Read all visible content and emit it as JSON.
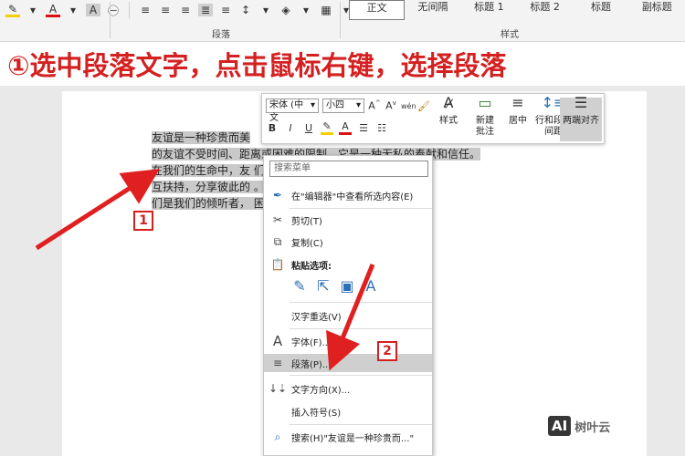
{
  "ribbon": {
    "paragraph_group": "段落",
    "styles_group": "样式",
    "styles": [
      "正文",
      "无间隔",
      "标题 1",
      "标题 2",
      "标题",
      "副标题"
    ]
  },
  "banner": {
    "text": "①选中段落文字，点击鼠标右键，选择段落"
  },
  "document": {
    "lines": [
      "友谊是一种珍贵而美",
      "的友谊不受时间、距离或困难的限制。它是一种无私的奉献和信任。",
      "在我们的生命中，友                         们与他人的心灵。朋友们相",
      "互扶持，分享彼此的                          。他们总是在我们身边。他",
      "们是我们的倾听者，                           困难时刻感到坚强和勇敢。"
    ]
  },
  "mini_toolbar": {
    "font": "宋体 (中文",
    "size": "小四",
    "buttons": [
      {
        "label": "样式",
        "icon": "styles-icon"
      },
      {
        "label": "新建\n批注",
        "icon": "new-comment-icon"
      },
      {
        "label": "居中",
        "icon": "center-icon"
      },
      {
        "label": "行和段落\n间距",
        "icon": "line-spacing-icon"
      },
      {
        "label": "两端对齐",
        "icon": "justify-icon"
      }
    ]
  },
  "context_menu": {
    "search_placeholder": "搜索菜单",
    "items": {
      "view_in_editor": "在\"编辑器\"中查看所选内容(E)",
      "cut": "剪切(T)",
      "copy": "复制(C)",
      "paste_options": "粘贴选项:",
      "reconvert": "汉字重选(V)",
      "font": "字体(F)...",
      "paragraph": "段落(P)...",
      "text_direction": "文字方向(X)...",
      "insert_symbol": "插入符号(S)",
      "search": "搜索(H)\"友谊是一种珍贵而...\""
    }
  },
  "callouts": {
    "step1": "1",
    "step2": "2"
  },
  "watermark": {
    "ai": "AI",
    "brand": "树叶云"
  },
  "colors": {
    "accent_red": "#d42020",
    "selection": "#c9c9c9"
  }
}
